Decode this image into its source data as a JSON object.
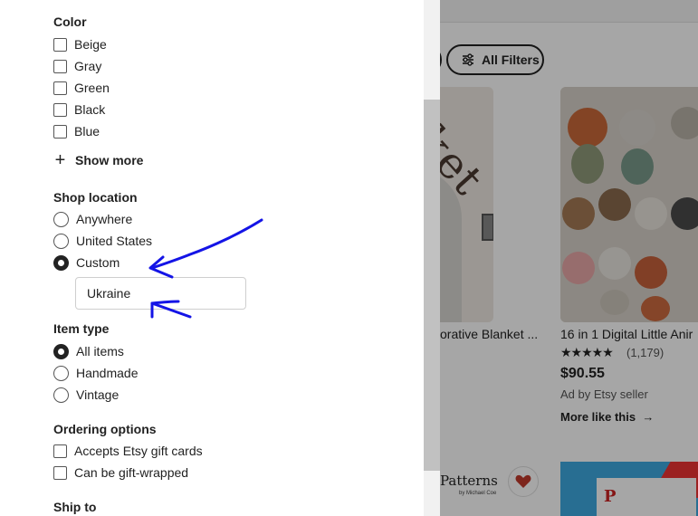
{
  "background": {
    "all_filters_label": "All Filters",
    "cards": [
      {
        "title": "orative Blanket ...",
        "image_text": "nket"
      },
      {
        "title": "16 in 1 Digital Little Anir",
        "rating_stars": "★★★★★",
        "review_count": "(1,179)",
        "price": "$90.55",
        "ad_label": "Ad by Etsy seller",
        "more_like_label": "More like this"
      }
    ],
    "bottom_card_logo": "Patterns",
    "bottom_card_sub": "by Michael Coe",
    "bottom_card_letter": "P"
  },
  "filters": {
    "color": {
      "title": "Color",
      "options": [
        "Beige",
        "Gray",
        "Green",
        "Black",
        "Blue"
      ],
      "show_more_label": "Show more"
    },
    "shop_location": {
      "title": "Shop location",
      "options": [
        "Anywhere",
        "United States",
        "Custom"
      ],
      "selected": "Custom",
      "custom_value": "Ukraine"
    },
    "item_type": {
      "title": "Item type",
      "options": [
        "All items",
        "Handmade",
        "Vintage"
      ],
      "selected": "All items"
    },
    "ordering": {
      "title": "Ordering options",
      "options": [
        "Accepts Etsy gift cards",
        "Can be gift-wrapped"
      ]
    },
    "ship_to": {
      "title": "Ship to"
    }
  },
  "colors": {
    "annotation": "#1414e6",
    "heart": "#c0392b"
  }
}
